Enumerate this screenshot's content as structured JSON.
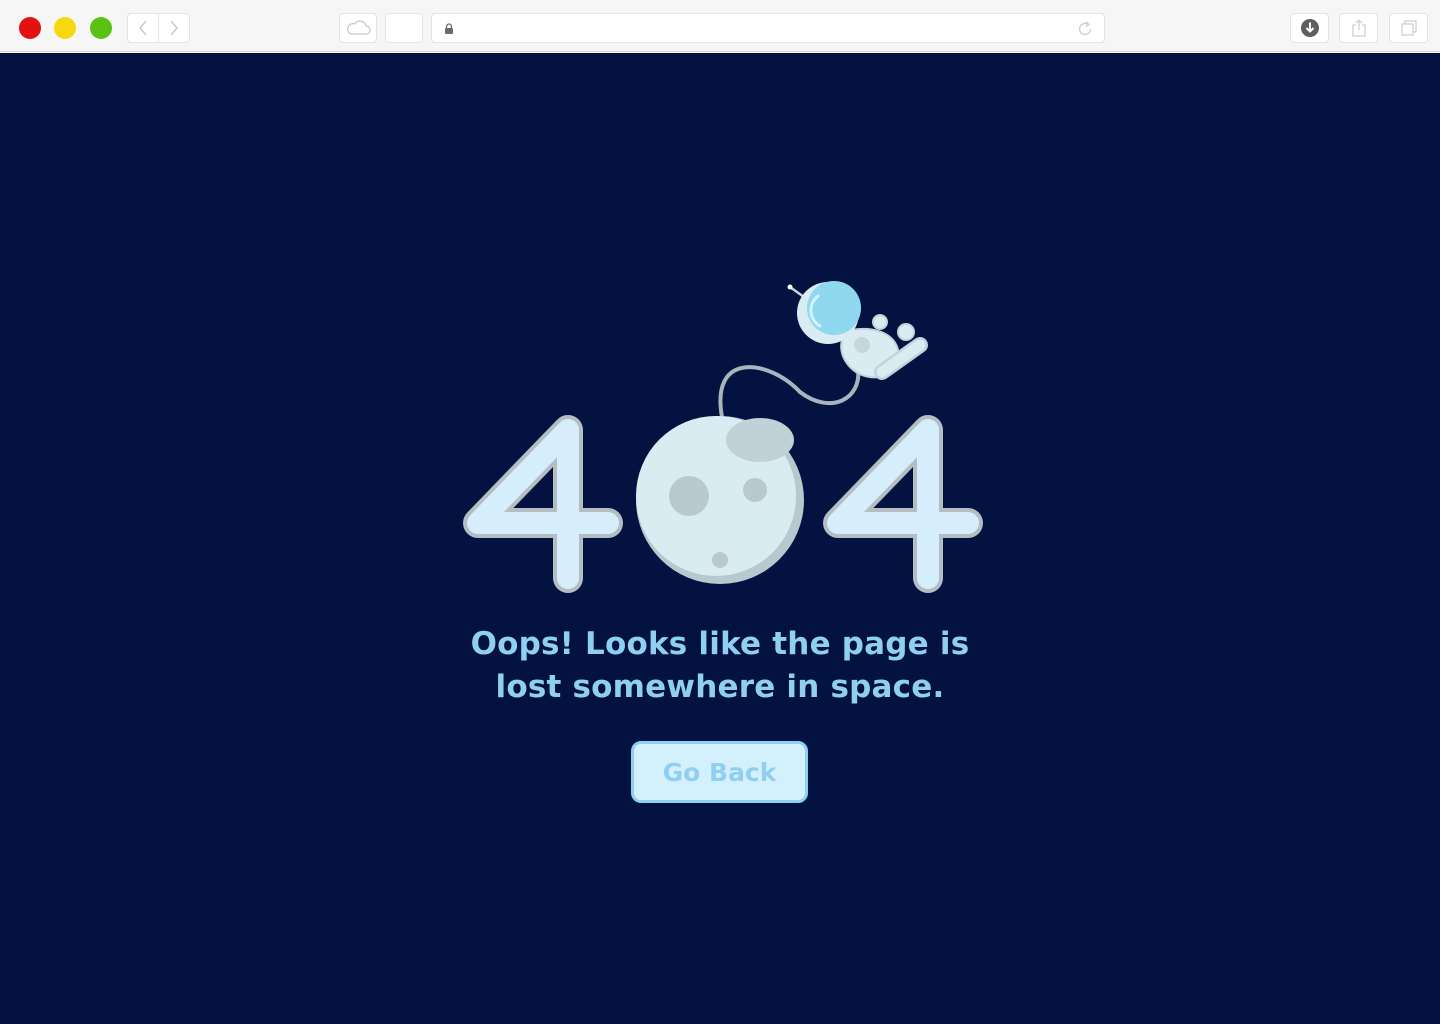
{
  "browser": {
    "icons": {
      "back": "chevron-left-icon",
      "forward": "chevron-right-icon",
      "cloud": "cloud-icon",
      "lock": "lock-icon",
      "reload": "reload-icon",
      "download": "download-icon",
      "share": "share-icon",
      "tabs": "tabs-icon"
    },
    "colors": {
      "close": "#e3110f",
      "minimize": "#f7d80f",
      "maximize": "#5ac213"
    }
  },
  "page": {
    "background": "#031240",
    "error_code_digits": [
      "4",
      "0",
      "4"
    ],
    "message_lines": [
      "Oops! Looks like the page is",
      "lost somewhere in space."
    ],
    "button": {
      "label": "Go Back"
    },
    "colors": {
      "accent": "#8fd0f2",
      "button_fill": "#d4f0fd",
      "moon": "#d9ecf2"
    },
    "illustration": {
      "digit_zero": "moon-icon",
      "figure": "astronaut-icon"
    }
  }
}
